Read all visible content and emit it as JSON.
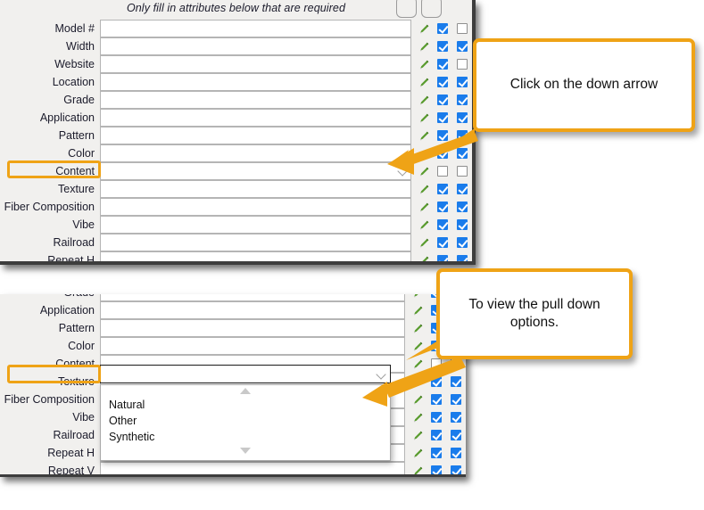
{
  "top_panel": {
    "header_note": "Only fill in attributes below that are required",
    "column_buttons": [
      "column-toggle-1",
      "column-toggle-2"
    ],
    "rows": [
      {
        "label": "Model #",
        "value": "",
        "edit_icon": "pencil-icon",
        "check1": true,
        "check2": false,
        "type": "text"
      },
      {
        "label": "Width",
        "value": "",
        "edit_icon": "pencil-icon",
        "check1": true,
        "check2": true,
        "type": "text"
      },
      {
        "label": "Website",
        "value": "",
        "edit_icon": "pencil-icon",
        "check1": true,
        "check2": false,
        "type": "text"
      },
      {
        "label": "Location",
        "value": "",
        "edit_icon": "pencil-icon",
        "check1": true,
        "check2": true,
        "type": "text"
      },
      {
        "label": "Grade",
        "value": "",
        "edit_icon": "pencil-icon",
        "check1": true,
        "check2": true,
        "type": "text"
      },
      {
        "label": "Application",
        "value": "",
        "edit_icon": "pencil-icon",
        "check1": true,
        "check2": true,
        "type": "text"
      },
      {
        "label": "Pattern",
        "value": "",
        "edit_icon": "pencil-icon",
        "check1": true,
        "check2": true,
        "type": "text"
      },
      {
        "label": "Color",
        "value": "",
        "edit_icon": "pencil-icon",
        "check1": true,
        "check2": true,
        "type": "text"
      },
      {
        "label": "Content",
        "value": "",
        "edit_icon": "pencil-icon",
        "check1": false,
        "check2": false,
        "type": "combobox"
      },
      {
        "label": "Texture",
        "value": "",
        "edit_icon": "pencil-icon",
        "check1": true,
        "check2": true,
        "type": "text"
      },
      {
        "label": "Fiber Composition",
        "value": "",
        "edit_icon": "pencil-icon",
        "check1": true,
        "check2": true,
        "type": "text"
      },
      {
        "label": "Vibe",
        "value": "",
        "edit_icon": "pencil-icon",
        "check1": true,
        "check2": true,
        "type": "text"
      },
      {
        "label": "Railroad",
        "value": "",
        "edit_icon": "pencil-icon",
        "check1": true,
        "check2": true,
        "type": "text"
      },
      {
        "label": "Repeat H",
        "value": "",
        "edit_icon": "pencil-icon",
        "check1": true,
        "check2": true,
        "type": "text"
      }
    ],
    "highlighted_row": "Content"
  },
  "bottom_panel": {
    "rows": [
      {
        "label": "Grade",
        "value": "",
        "edit_icon": "pencil-icon",
        "check1": true,
        "check2": true,
        "type": "text"
      },
      {
        "label": "Application",
        "value": "",
        "edit_icon": "pencil-icon",
        "check1": true,
        "check2": true,
        "type": "text"
      },
      {
        "label": "Pattern",
        "value": "",
        "edit_icon": "pencil-icon",
        "check1": true,
        "check2": true,
        "type": "text"
      },
      {
        "label": "Color",
        "value": "",
        "edit_icon": "pencil-icon",
        "check1": true,
        "check2": true,
        "type": "text"
      },
      {
        "label": "Content",
        "value": "",
        "edit_icon": "pencil-icon",
        "check1": false,
        "check2": false,
        "type": "combobox-open"
      },
      {
        "label": "Texture",
        "value": "",
        "edit_icon": "pencil-icon",
        "check1": true,
        "check2": true,
        "type": "text"
      },
      {
        "label": "Fiber Composition",
        "value": "",
        "edit_icon": "pencil-icon",
        "check1": true,
        "check2": true,
        "type": "text"
      },
      {
        "label": "Vibe",
        "value": "",
        "edit_icon": "pencil-icon",
        "check1": true,
        "check2": true,
        "type": "text"
      },
      {
        "label": "Railroad",
        "value": "",
        "edit_icon": "pencil-icon",
        "check1": true,
        "check2": true,
        "type": "text"
      },
      {
        "label": "Repeat H",
        "value": "",
        "edit_icon": "pencil-icon",
        "check1": true,
        "check2": true,
        "type": "text"
      },
      {
        "label": "Repeat V",
        "value": "",
        "edit_icon": "pencil-icon",
        "check1": true,
        "check2": true,
        "type": "text"
      }
    ],
    "highlighted_row": "Content",
    "dropdown": {
      "open": true,
      "options": [
        "Natural",
        "Other",
        "Synthetic"
      ],
      "scroll_up_icon": "triangle-up-icon",
      "scroll_down_icon": "triangle-down-icon"
    }
  },
  "callouts": [
    {
      "id": "callout-1",
      "text": "Click on the down arrow"
    },
    {
      "id": "callout-2",
      "text": "To view the pull down options."
    }
  ],
  "colors": {
    "accent": "#efa316",
    "checkbox": "#1a7ceb",
    "pencil": "#5a9c2f",
    "panel_bg": "#f1f0ee",
    "field_bg": "#ffffff",
    "border_dark": "#3d3d3d"
  }
}
